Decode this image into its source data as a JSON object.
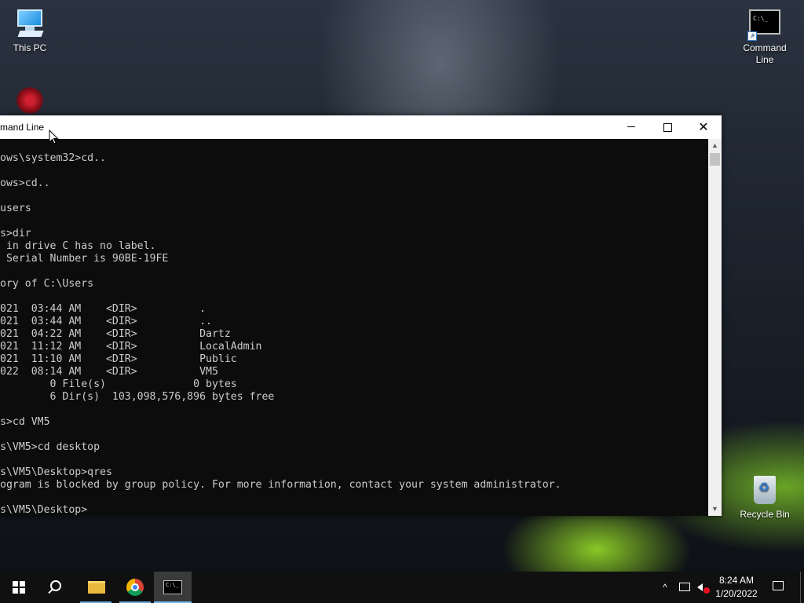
{
  "desktop": {
    "icons": {
      "this_pc": "This PC",
      "command_line": "Command Line",
      "recycle_bin": "Recycle Bin"
    }
  },
  "window": {
    "title": "mand Line",
    "controls": {
      "minimize": "minimize-icon",
      "maximize": "maximize-icon",
      "close": "close-icon"
    },
    "console_text": "ows\\system32>cd..\n\nows>cd..\n\nusers\n\ns>dir\n in drive C has no label.\n Serial Number is 90BE-19FE\n\nory of C:\\Users\n\n021  03:44 AM    <DIR>          .\n021  03:44 AM    <DIR>          ..\n021  04:22 AM    <DIR>          Dartz\n021  11:12 AM    <DIR>          LocalAdmin\n021  11:10 AM    <DIR>          Public\n022  08:14 AM    <DIR>          VM5\n        0 File(s)              0 bytes\n        6 Dir(s)  103,098,576,896 bytes free\n\ns>cd VM5\n\ns\\VM5>cd desktop\n\ns\\VM5\\Desktop>qres\nogram is blocked by group policy. For more information, contact your system administrator.\n\ns\\VM5\\Desktop>"
  },
  "taskbar": {
    "icons": [
      "windows-start-icon",
      "search-icon",
      "file-explorer-icon",
      "chrome-icon",
      "command-prompt-icon"
    ],
    "tray": {
      "chevron": "^",
      "time": "8:24 AM",
      "date": "1/20/2022"
    }
  },
  "colors": {
    "console_bg": "#0c0c0c",
    "console_fg": "#cccccc",
    "taskbar_bg": "#101010",
    "accent": "#76b9ed"
  }
}
